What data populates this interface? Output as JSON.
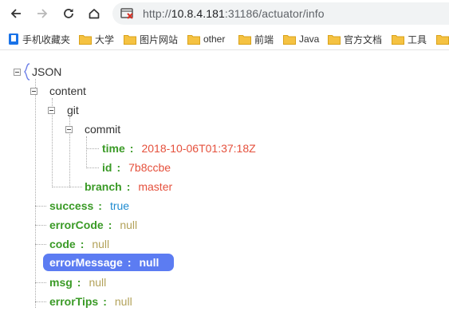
{
  "toolbar": {
    "url_prefix": "http://",
    "url_host": "10.8.4.181",
    "url_rest": ":31186/actuator/info"
  },
  "bookmarks": [
    {
      "label": "手机收藏夹",
      "icon": "mobile-bookmarks-icon"
    },
    {
      "label": "大学",
      "icon": "folder-icon"
    },
    {
      "label": "图片网站",
      "icon": "folder-icon"
    },
    {
      "label": "other",
      "icon": "folder-icon"
    },
    {
      "label": "前端",
      "icon": "folder-icon"
    },
    {
      "label": "Java",
      "icon": "folder-icon"
    },
    {
      "label": "官方文档",
      "icon": "folder-icon"
    },
    {
      "label": "工具",
      "icon": "folder-icon"
    }
  ],
  "tree": {
    "root": "JSON",
    "content": "content",
    "git": "git",
    "commit": "commit",
    "time_key": "time",
    "time_val": "2018-10-06T01:37:18Z",
    "id_key": "id",
    "id_val": "7b8ccbe",
    "branch_key": "branch",
    "branch_val": "master",
    "success_key": "success",
    "success_val": "true",
    "errorCode_key": "errorCode",
    "errorCode_val": "null",
    "code_key": "code",
    "code_val": "null",
    "errorMessage_key": "errorMessage",
    "errorMessage_val": "null",
    "msg_key": "msg",
    "msg_val": "null",
    "errorTips_key": "errorTips",
    "errorTips_val": "null"
  },
  "colors": {
    "key_green": "#3a9a26",
    "string_red": "#e5503c",
    "bool_blue": "#1f8bd0",
    "null_olive": "#b3a25a",
    "selection_blue": "#5c7cf2"
  }
}
